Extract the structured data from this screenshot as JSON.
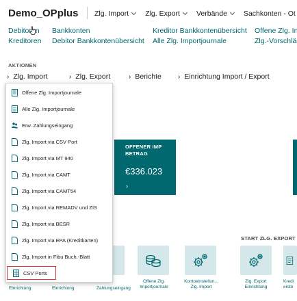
{
  "header": {
    "company": "Demo_OPplus",
    "nav": [
      "Zlg. Import",
      "Zlg. Export",
      "Verbände",
      "Sachkonten - Ot"
    ]
  },
  "links": {
    "row1": [
      "Debitoren",
      "Bankkonten",
      "Kreditor Bankkontenübersicht",
      "Offene Zlg. In"
    ],
    "row2": [
      "Kreditoren",
      "Debitor Bankkontenübersicht",
      "Alle Zlg. Importjournale",
      "Zlg.-Vorschläg"
    ]
  },
  "actions": {
    "title": "AKTIONEN",
    "items": [
      "Zlg. Import",
      "Zlg. Export",
      "Berichte",
      "Einrichtung Import / Export"
    ]
  },
  "menu": {
    "items": [
      "Offene Zlg. Importjournale",
      "Alle Zlg. Importjournale",
      "Erw. Zahlungseingang",
      "Zlg. Import via CSV Port",
      "Zlg. Import via MT 940",
      "Zlg. Import via CAMT",
      "Zlg. Import via CAMT54",
      "Zlg. Import via REMADV und ZIS",
      "Zlg. Import via BESR",
      "Zlg. Import via EPA (Kreditkarten)",
      "Zlg. Import in Fibu Buch.-Blatt",
      "CSV Ports"
    ]
  },
  "tile": {
    "label_line1": "OFFENER IMP",
    "label_line2": "BETRAG",
    "value": "€336.023",
    "arrow": "›"
  },
  "start_export": {
    "title": "START ZLG. EXPORT"
  },
  "icon_buttons": [
    {
      "label1": "Offene Zlg.",
      "label2": "Importjournale",
      "icon": "coins-icon"
    },
    {
      "label1": "Kontoeinstellun...",
      "label2": "Zlg. Import",
      "icon": "gears-icon"
    },
    {
      "label1": "Zlg. Export",
      "label2": "Einrichtung",
      "icon": "gears-icon"
    },
    {
      "label1": "Kredi",
      "label2": "erste",
      "icon": "document-icon"
    }
  ],
  "bottom_labels": [
    "Einrichtung",
    "Einrichtung",
    "Zahlungseingang"
  ],
  "colors": {
    "teal": "#00686e",
    "link": "#00676f",
    "highlight": "#d9363e",
    "tile_light": "#d4e7ea"
  }
}
